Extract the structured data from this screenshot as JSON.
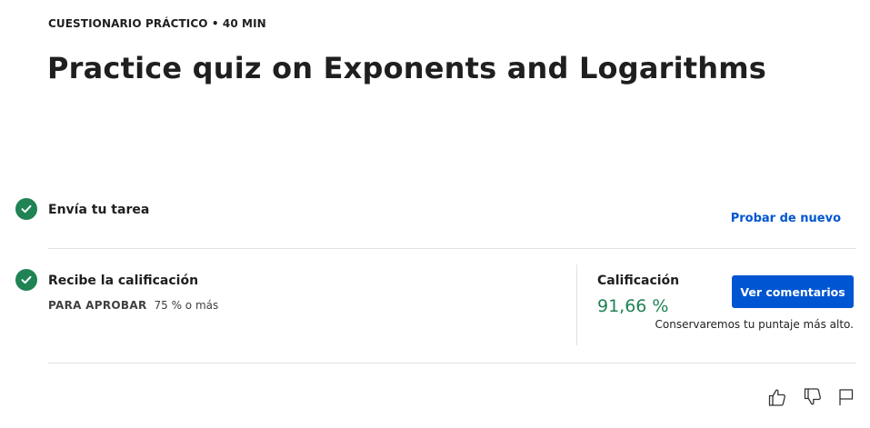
{
  "header": {
    "eyebrow": "CUESTIONARIO PRÁCTICO • 40 MIN",
    "title": "Practice quiz on Exponents and Logarithms"
  },
  "steps": [
    {
      "title": "Envía tu tarea",
      "status_icon": "check-circle-icon",
      "action_label": "Probar de nuevo"
    },
    {
      "title": "Recibe la calificación",
      "status_icon": "check-circle-icon",
      "pass_label": "PARA APROBAR",
      "pass_value": "75 % o más"
    }
  ],
  "grade": {
    "label": "Calificación",
    "value": "91,66 %",
    "button_label": "Ver comentarios",
    "note": "Conservaremos tu puntaje más alto."
  },
  "feedback_icons": [
    "thumbs-up-icon",
    "thumbs-down-icon",
    "flag-icon"
  ],
  "colors": {
    "success": "#1f8354",
    "accent": "#0056d2",
    "divider": "#e1e1e1"
  }
}
